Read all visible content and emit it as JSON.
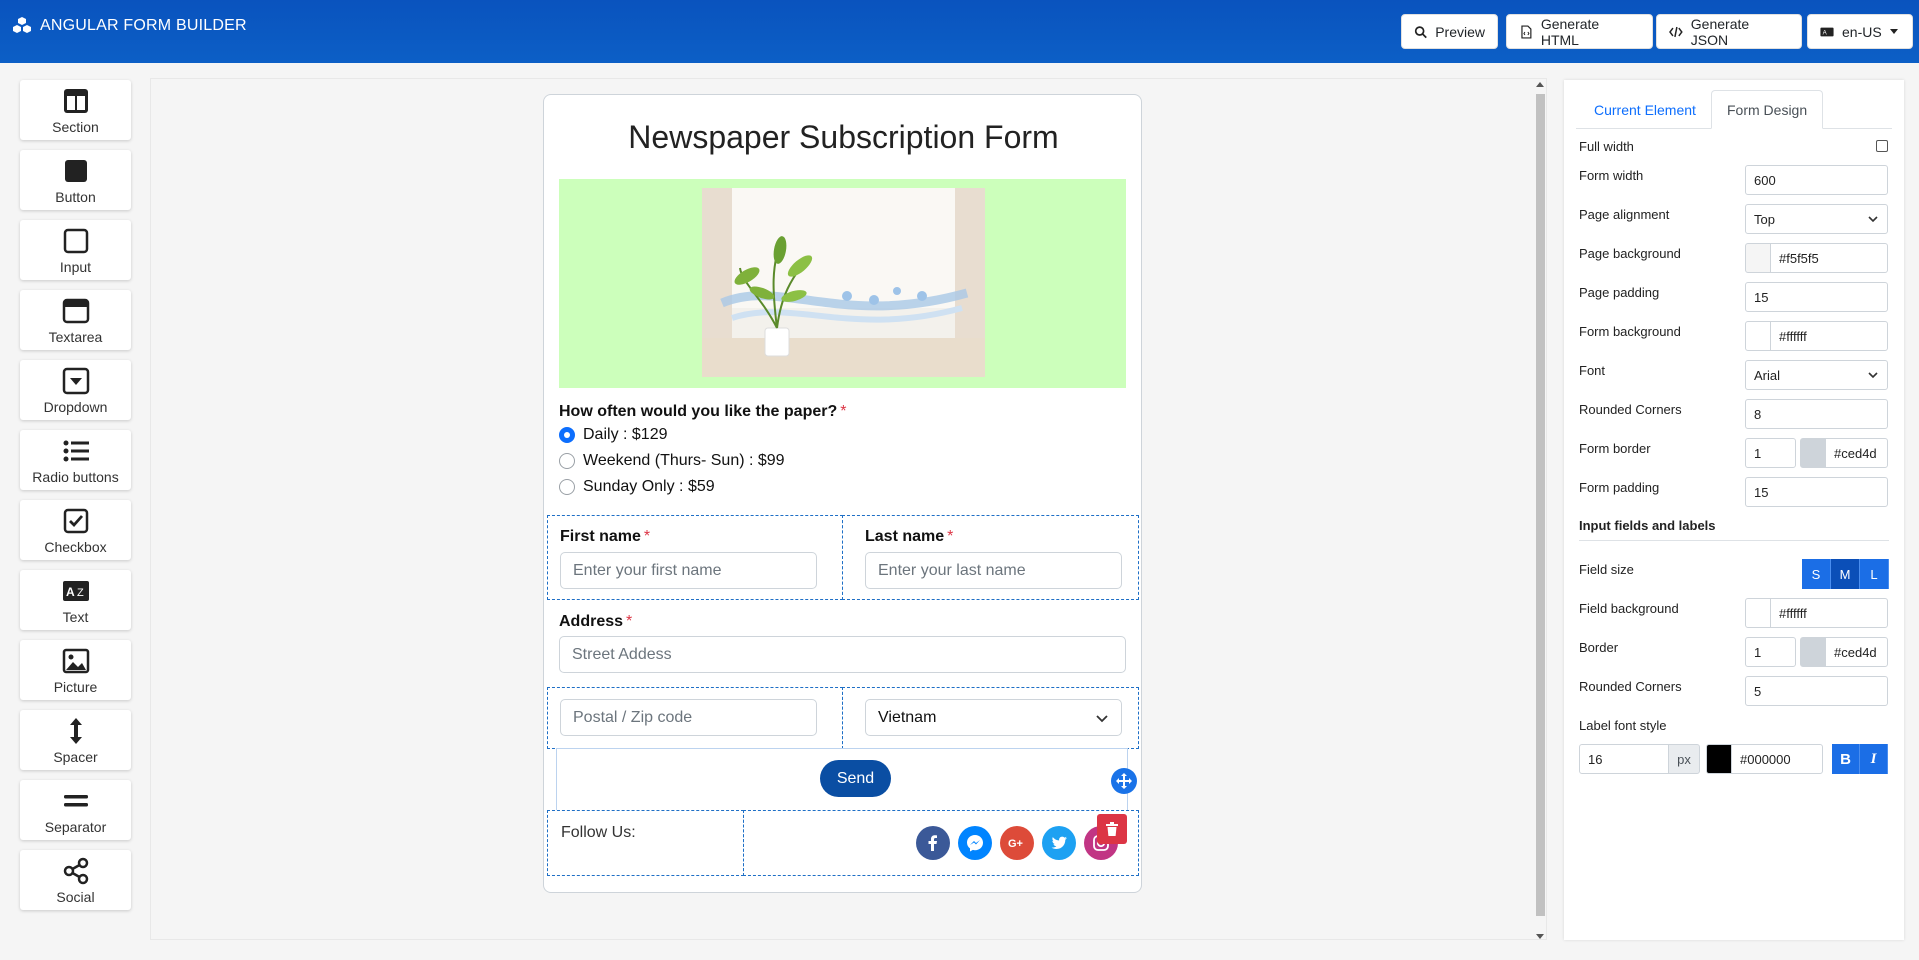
{
  "app": {
    "title": "ANGULAR FORM BUILDER",
    "buttons": {
      "preview": "Preview",
      "generate_html": "Generate HTML",
      "generate_json": "Generate JSON",
      "locale": "en-US"
    }
  },
  "palette": {
    "items": [
      {
        "label": "Section",
        "icon": "section-icon"
      },
      {
        "label": "Button",
        "icon": "button-icon"
      },
      {
        "label": "Input",
        "icon": "input-icon"
      },
      {
        "label": "Textarea",
        "icon": "textarea-icon"
      },
      {
        "label": "Dropdown",
        "icon": "dropdown-icon"
      },
      {
        "label": "Radio buttons",
        "icon": "radio-list-icon"
      },
      {
        "label": "Checkbox",
        "icon": "checkbox-icon"
      },
      {
        "label": "Text",
        "icon": "text-icon"
      },
      {
        "label": "Picture",
        "icon": "picture-icon"
      },
      {
        "label": "Spacer",
        "icon": "spacer-icon"
      },
      {
        "label": "Separator",
        "icon": "separator-icon"
      },
      {
        "label": "Social",
        "icon": "share-icon"
      }
    ]
  },
  "form": {
    "title": "Newspaper Subscription Form",
    "hero_background": "#ccffbb",
    "question": "How often would you like the paper?",
    "required_mark": "*",
    "options": [
      {
        "label": "Daily : $129",
        "checked": true
      },
      {
        "label": "Weekend (Thurs- Sun) : $99",
        "checked": false
      },
      {
        "label": "Sunday Only : $59",
        "checked": false
      }
    ],
    "first_name": {
      "label": "First name",
      "placeholder": "Enter your first name"
    },
    "last_name": {
      "label": "Last name",
      "placeholder": "Enter your last name"
    },
    "address": {
      "label": "Address",
      "placeholder": "Street Addess"
    },
    "postal": {
      "placeholder": "Postal / Zip code"
    },
    "country": {
      "value": "Vietnam"
    },
    "send_label": "Send",
    "follow_label": "Follow Us:",
    "social": [
      {
        "name": "facebook-icon",
        "color": "#3b5998"
      },
      {
        "name": "messenger-icon",
        "color": "#0084ff"
      },
      {
        "name": "google-plus-icon",
        "color": "#dd4b39"
      },
      {
        "name": "twitter-icon",
        "color": "#1da1f2"
      },
      {
        "name": "instagram-icon",
        "color": "#c13584"
      }
    ]
  },
  "panel": {
    "tabs": {
      "current": "Current Element",
      "design": "Form Design"
    },
    "full_width": "Full width",
    "form_width": {
      "label": "Form width",
      "value": "600"
    },
    "page_alignment": {
      "label": "Page alignment",
      "value": "Top"
    },
    "page_background": {
      "label": "Page background",
      "value": "#f5f5f5",
      "swatch": "#f5f5f5"
    },
    "page_padding": {
      "label": "Page padding",
      "value": "15"
    },
    "form_background": {
      "label": "Form background",
      "value": "#ffffff",
      "swatch": "#ffffff"
    },
    "font": {
      "label": "Font",
      "value": "Arial"
    },
    "rounded_corners": {
      "label": "Rounded Corners",
      "value": "8"
    },
    "form_border": {
      "label": "Form border",
      "width": "1",
      "color": "#ced4d",
      "swatch": "#ced4da"
    },
    "form_padding": {
      "label": "Form padding",
      "value": "15"
    },
    "section_inputs": "Input fields and labels",
    "field_size": {
      "label": "Field size",
      "options": [
        "S",
        "M",
        "L"
      ],
      "selected": "M"
    },
    "field_background": {
      "label": "Field background",
      "value": "#ffffff",
      "swatch": "#ffffff"
    },
    "border": {
      "label": "Border",
      "width": "1",
      "color": "#ced4d",
      "swatch": "#ced4da"
    },
    "field_rounded": {
      "label": "Rounded Corners",
      "value": "5"
    },
    "label_font_style": {
      "label": "Label font style",
      "size": "16",
      "unit": "px",
      "color": "#000000",
      "swatch": "#000000",
      "bold": "B",
      "italic": "I"
    }
  }
}
